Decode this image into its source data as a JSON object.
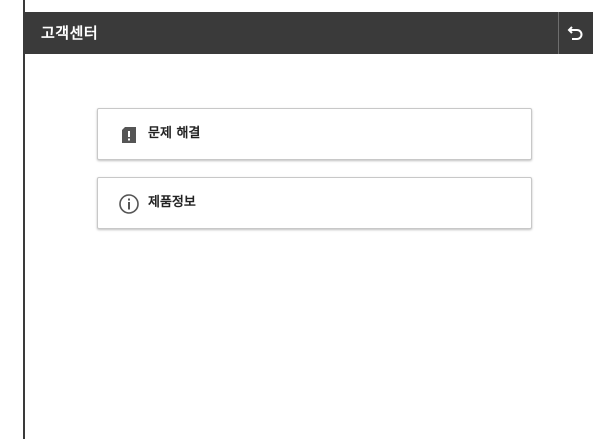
{
  "header": {
    "title": "고객센터",
    "back_icon": "back-arrow-icon"
  },
  "menu": {
    "items": [
      {
        "label": "문제 해결",
        "icon": "troubleshoot-alert-icon"
      },
      {
        "label": "제품정보",
        "icon": "info-circle-icon"
      }
    ]
  },
  "colors": {
    "titlebar_bg": "#3a3a3a",
    "titlebar_text": "#ffffff",
    "button_bg": "#ffffff",
    "button_text": "#222222",
    "icon_color": "#555555"
  }
}
